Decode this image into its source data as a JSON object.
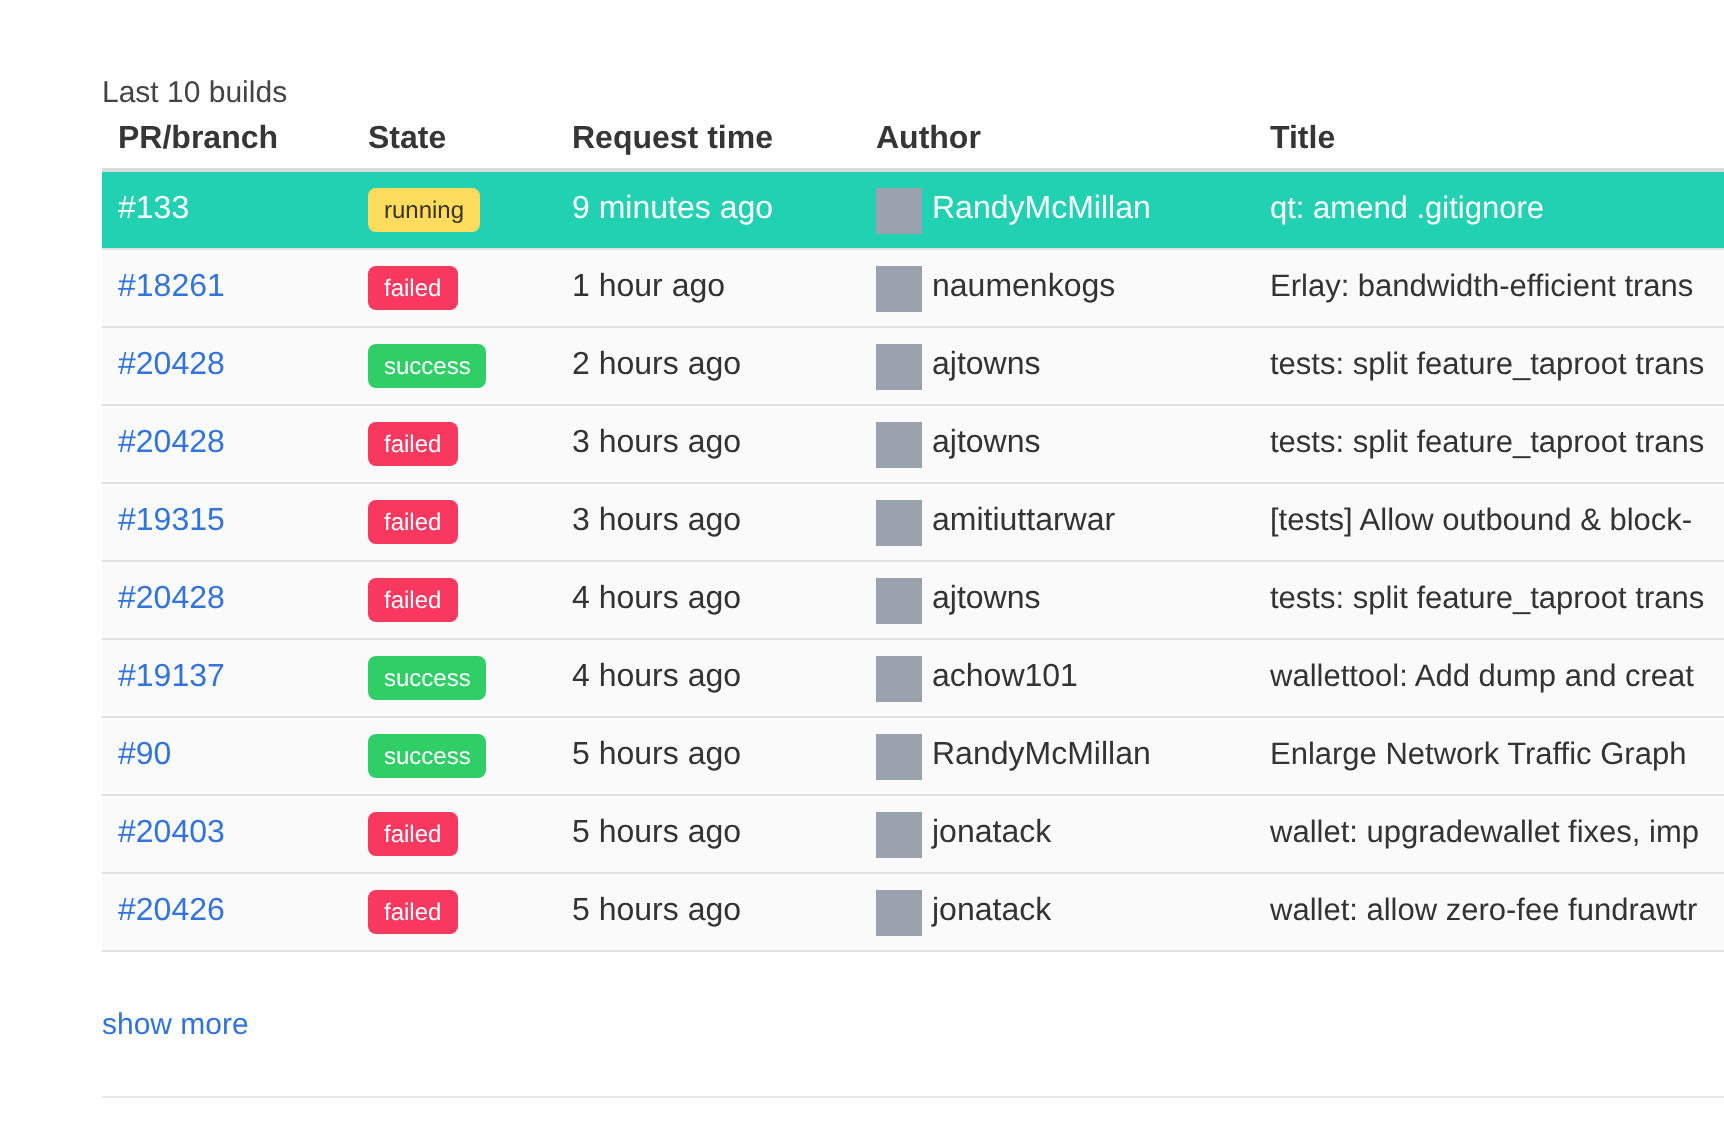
{
  "caption": "Last 10 builds",
  "columns": [
    "PR/branch",
    "State",
    "Request time",
    "Author",
    "Title"
  ],
  "rows": [
    {
      "pr": "#133",
      "state": "running",
      "time": "9 minutes ago",
      "author": "RandyMcMillan",
      "title": "qt: amend .gitignore",
      "selected": true
    },
    {
      "pr": "#18261",
      "state": "failed",
      "time": "1 hour ago",
      "author": "naumenkogs",
      "title": "Erlay: bandwidth-efficient trans",
      "selected": false
    },
    {
      "pr": "#20428",
      "state": "success",
      "time": "2 hours ago",
      "author": "ajtowns",
      "title": "tests: split feature_taproot trans",
      "selected": false
    },
    {
      "pr": "#20428",
      "state": "failed",
      "time": "3 hours ago",
      "author": "ajtowns",
      "title": "tests: split feature_taproot trans",
      "selected": false
    },
    {
      "pr": "#19315",
      "state": "failed",
      "time": "3 hours ago",
      "author": "amitiuttarwar",
      "title": "[tests] Allow outbound & block-",
      "selected": false
    },
    {
      "pr": "#20428",
      "state": "failed",
      "time": "4 hours ago",
      "author": "ajtowns",
      "title": "tests: split feature_taproot trans",
      "selected": false
    },
    {
      "pr": "#19137",
      "state": "success",
      "time": "4 hours ago",
      "author": "achow101",
      "title": "wallettool: Add dump and creat",
      "selected": false
    },
    {
      "pr": "#90",
      "state": "success",
      "time": "5 hours ago",
      "author": "RandyMcMillan",
      "title": "Enlarge Network Traffic Graph",
      "selected": false
    },
    {
      "pr": "#20403",
      "state": "failed",
      "time": "5 hours ago",
      "author": "jonatack",
      "title": "wallet: upgradewallet fixes, imp",
      "selected": false
    },
    {
      "pr": "#20426",
      "state": "failed",
      "time": "5 hours ago",
      "author": "jonatack",
      "title": "wallet: allow zero-fee fundrawtr",
      "selected": false
    }
  ],
  "show_more": "show more"
}
